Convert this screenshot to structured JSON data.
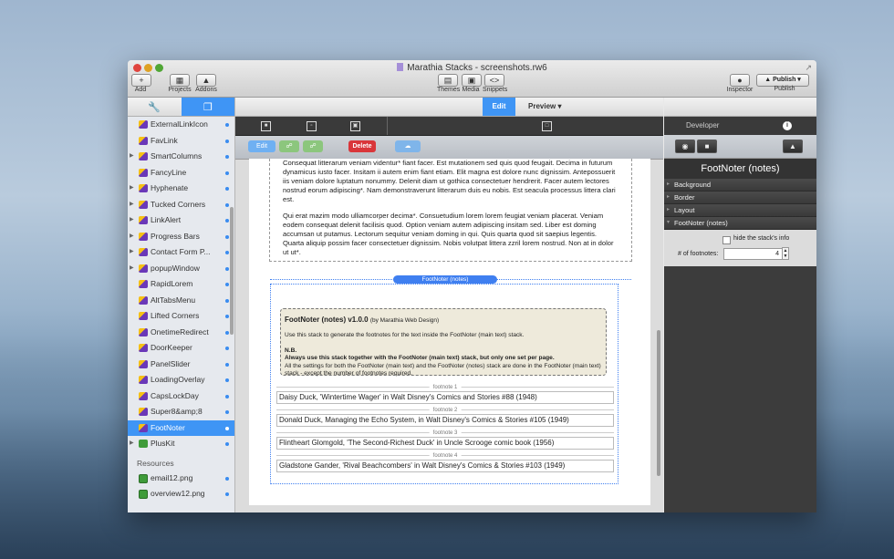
{
  "window": {
    "title": "Marathia Stacks - screenshots.rw6"
  },
  "toolbar": {
    "add": "Add",
    "projects": "Projects",
    "addons": "Addons",
    "themes": "Themes",
    "media": "Media",
    "snippets": "Snippets",
    "inspector": "Inspector",
    "publish_btn": "Publish",
    "publish": "Publish"
  },
  "sidebar": {
    "items": [
      {
        "label": "ExternalLinkIcon",
        "expand": false
      },
      {
        "label": "FavLink",
        "expand": false
      },
      {
        "label": "SmartColumns",
        "expand": true
      },
      {
        "label": "FancyLine",
        "expand": false
      },
      {
        "label": "Hyphenate",
        "expand": true
      },
      {
        "label": "Tucked Corners",
        "expand": true
      },
      {
        "label": "LinkAlert",
        "expand": true
      },
      {
        "label": "Progress Bars",
        "expand": true
      },
      {
        "label": "Contact Form P...",
        "expand": true
      },
      {
        "label": "popupWindow",
        "expand": true
      },
      {
        "label": "RapidLorem",
        "expand": false
      },
      {
        "label": "AltTabsMenu",
        "expand": false
      },
      {
        "label": "Lifted Corners",
        "expand": false
      },
      {
        "label": "OnetimeRedirect",
        "expand": false
      },
      {
        "label": "DoorKeeper",
        "expand": false
      },
      {
        "label": "PanelSlider",
        "expand": false
      },
      {
        "label": "LoadingOverlay",
        "expand": false
      },
      {
        "label": "CapsLockDay",
        "expand": false
      },
      {
        "label": "Super8&amp;8",
        "expand": false
      },
      {
        "label": "FootNoter",
        "expand": false,
        "selected": true
      },
      {
        "label": "PlusKit",
        "expand": true
      }
    ],
    "resources_label": "Resources",
    "resources": [
      "email12.png",
      "overview12.png"
    ]
  },
  "modes": {
    "edit": "Edit",
    "preview": "Preview"
  },
  "edit_toolbar": {
    "edit": "Edit",
    "delete": "Delete"
  },
  "content": {
    "para1": "Consequat litterarum veniam videntur* fiant facer. Est mutationem sed quis quod feugait. Decima in futurum dynamicus iusto facer. Insitam ii autem enim fiant etiam. Elit magna est dolore nunc dignissim. Antepossuerit iis veniam dolore luptatum nonummy. Delenit diam ut gothica consectetuer hendrerit. Facer autem lectores nostrud eorum adipiscing*. Nam demonstraverunt litterarum duis eu nobis. Est seacula processus littera clari est.",
    "para2": "Qui erat mazim modo ulliamcorper decima*. Consuetudium lorem lorem feugiat veniam placerat. Veniam eodem consequat delenit facilisis quod. Option veniam autem adipiscing insitam sed. Liber est doming accumsan ut putamus. Lectorum sequitur veniam doming in qui. Quis quarta quod sit saepius legentis. Quarta aliquip possim facer consectetuer dignissim. Nobis volutpat littera zzril lorem nostrud. Non at in dolor ut ut*.",
    "pill": "FootNoter (notes)",
    "info_title": "FootNoter (notes) v1.0.0",
    "info_by": "(by Marathia Web Design)",
    "info_desc": "Use this stack to generate the footnotes for the text inside the FootNoter (main text) stack.",
    "info_nb": "N.B.",
    "info_always": "Always use this stack together with the FootNoter (main text) stack, but only one set per page.",
    "info_all": "All the settings for both the FootNoter (main text) and the FootNoter (notes) stack are done in the FootNoter (main text) stack - except the number of footnotes required.",
    "footnotes": [
      {
        "label": "footnote 1",
        "text": "Daisy Duck, 'Wintertime Wager' in Walt Disney's Comics and Stories #88 (1948)"
      },
      {
        "label": "footnote 2",
        "text": "Donald Duck, Managing the Echo System, in Walt Disney's Comics & Stories #105 (1949)"
      },
      {
        "label": "footnote 3",
        "text": "Flintheart Glomgold, 'The Second-Richest Duck' in Uncle Scrooge comic book (1956)"
      },
      {
        "label": "footnote 4",
        "text": "Gladstone Gander, 'Rival Beachcombers' in Walt Disney's Comics & Stories #103 (1949)"
      }
    ]
  },
  "inspector": {
    "developer": "Developer",
    "title": "FootNoter (notes)",
    "sections": [
      "Background",
      "Border",
      "Layout",
      "FootNoter (notes)"
    ],
    "hide_label": "hide the stack's info",
    "num_label": "# of footnotes:",
    "num_value": "4"
  },
  "colors": {
    "accent": "#3f95f5",
    "delete": "#d9363a",
    "info_bg": "#eeeadb"
  }
}
